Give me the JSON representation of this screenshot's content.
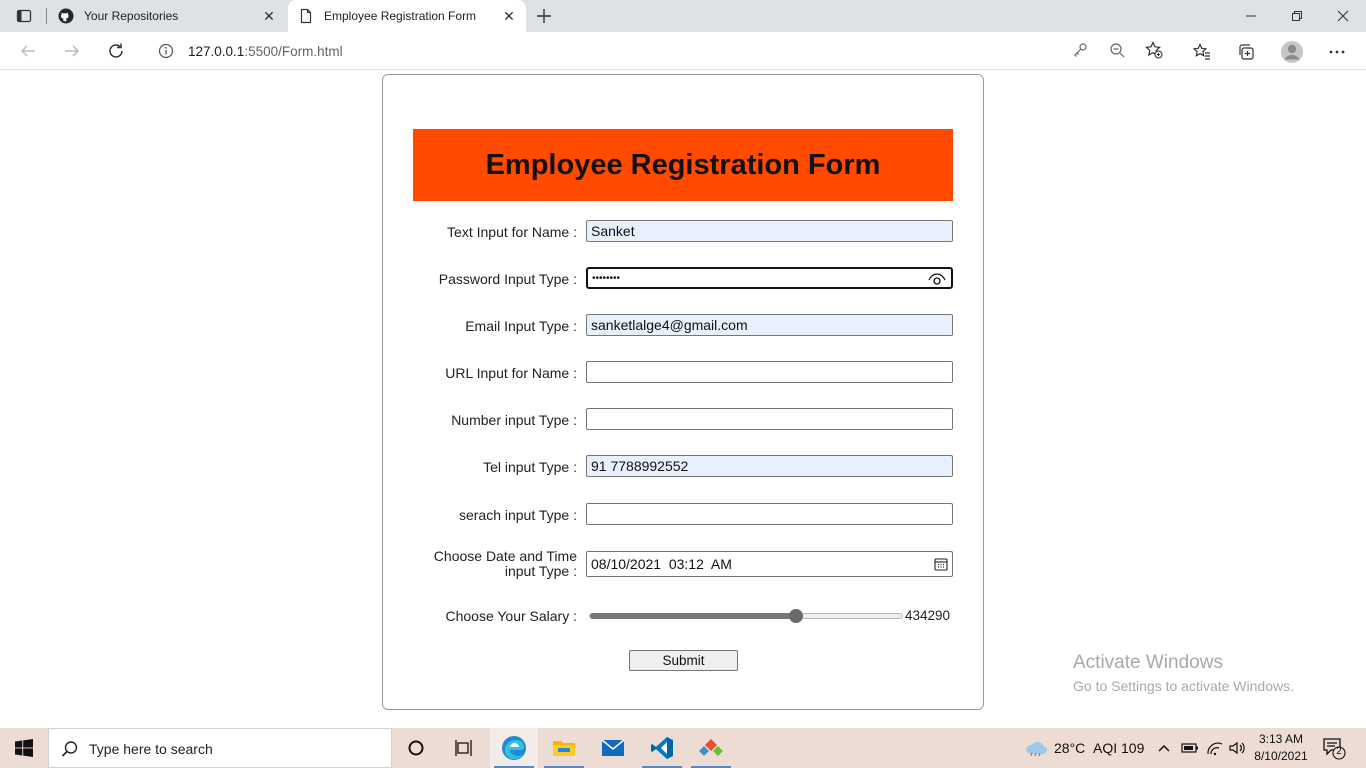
{
  "browser": {
    "tabs": [
      {
        "title": "Your Repositories",
        "active": false,
        "icon": "github-icon"
      },
      {
        "title": "Employee Registration Form",
        "active": true,
        "icon": "page-icon"
      }
    ],
    "address": {
      "host": "127.0.0.1",
      "path": ":5500/Form.html"
    }
  },
  "form": {
    "heading": "Employee Registration Form",
    "header_color": "#ff4a00",
    "fields": [
      {
        "label": "Text Input for Name :",
        "value": "Sanket",
        "type": "text",
        "autofilled": true
      },
      {
        "label": "Password Input Type :",
        "value": "••••••••",
        "type": "password",
        "focused": true
      },
      {
        "label": "Email Input Type :",
        "value": "sanketlalge4@gmail.com",
        "type": "email",
        "autofilled": true
      },
      {
        "label": "URL Input for Name :",
        "value": "",
        "type": "url"
      },
      {
        "label": "Number input Type :",
        "value": "",
        "type": "number"
      },
      {
        "label": "Tel input Type :",
        "value": "91 7788992552",
        "type": "tel",
        "autofilled": true
      },
      {
        "label": "serach input Type :",
        "value": "",
        "type": "search"
      },
      {
        "label": "Choose Date and Time input Type :",
        "value": "08/10/2021  03:12  AM",
        "type": "datetime-local"
      }
    ],
    "salary": {
      "label": "Choose Your Salary :",
      "value": "434290",
      "fraction": 0.66
    },
    "submit_label": "Submit"
  },
  "watermark": {
    "line1": "Activate Windows",
    "line2": "Go to Settings to activate Windows."
  },
  "taskbar": {
    "search_placeholder": "Type here to search",
    "weather": "28°C",
    "aqi": "AQI 109",
    "time": "3:13 AM",
    "date": "8/10/2021",
    "notification_count": "2"
  }
}
